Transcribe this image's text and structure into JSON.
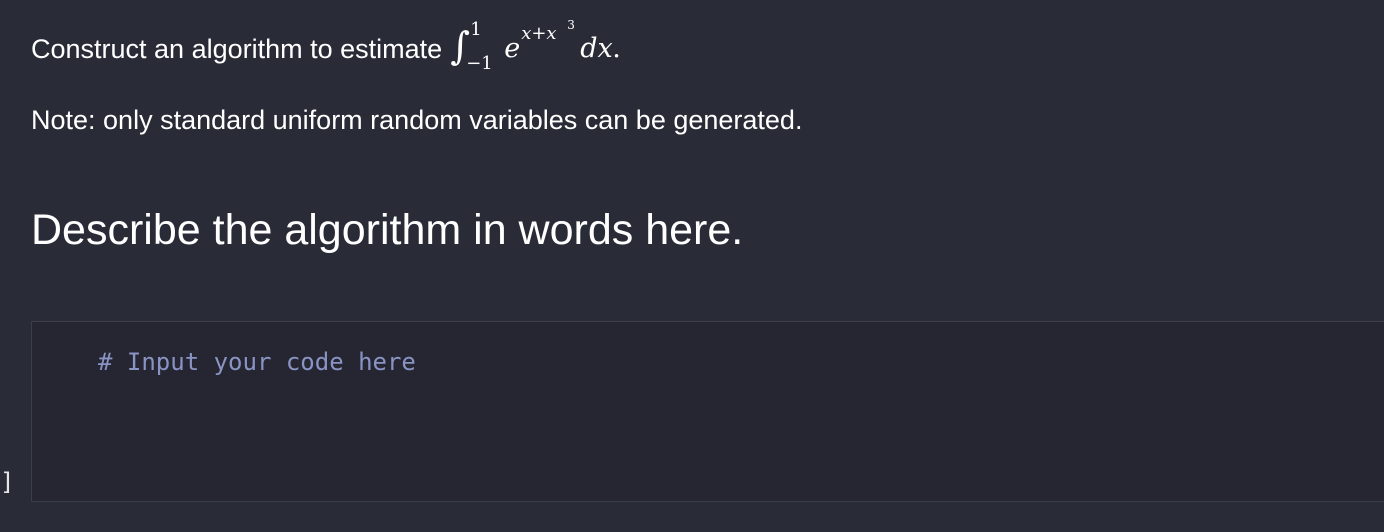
{
  "question": {
    "prefix": "Construct an algorithm to estimate",
    "math": {
      "integral": "∫",
      "upper": "1",
      "lower": "−1",
      "base": "e",
      "exponent": "x+x",
      "exponent_power": "3",
      "differential": "dx",
      "trailing": "."
    }
  },
  "note": "Note: only standard uniform random variables can be generated.",
  "heading": "Describe the algorithm in words here.",
  "code_cell": {
    "code": "# Input your code here",
    "prompt_bracket": "]"
  },
  "colors": {
    "background": "#292b37",
    "code_background": "#252631",
    "comment": "#8a94c4",
    "text": "#ffffff"
  }
}
